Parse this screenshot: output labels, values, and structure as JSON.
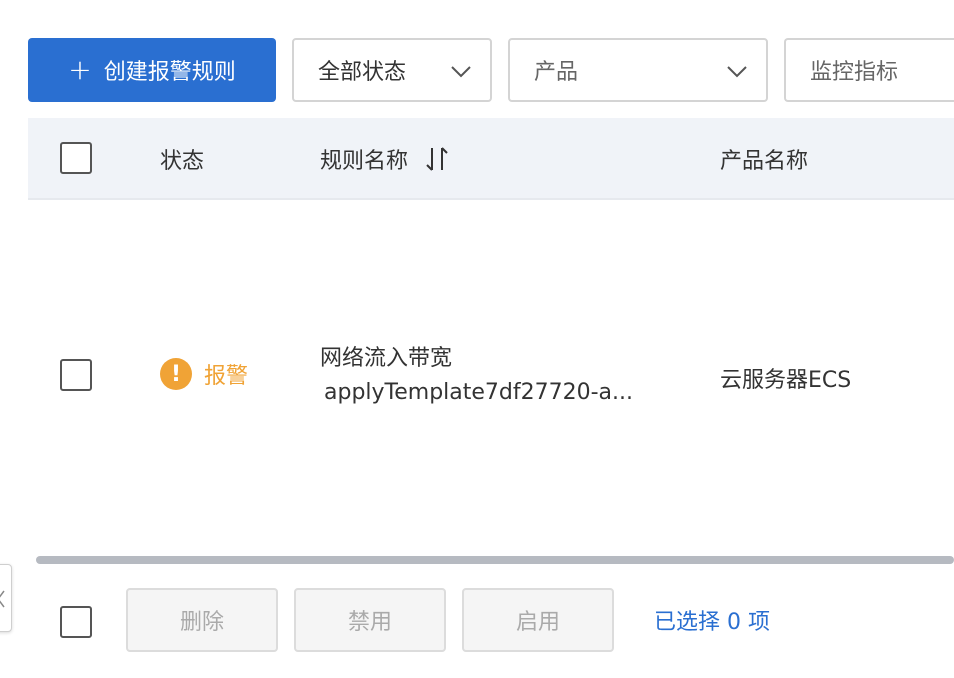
{
  "toolbar": {
    "create_label": "创建报警规则",
    "status_filter": "全部状态",
    "product_placeholder": "产品",
    "metric_placeholder": "监控指标"
  },
  "table": {
    "headers": {
      "status": "状态",
      "rule_name": "规则名称",
      "product_name": "产品名称"
    },
    "rows": [
      {
        "status": "报警",
        "rule_name": "网络流入带宽",
        "rule_id": "applyTemplate7df27720-a...",
        "product": "云服务器ECS"
      }
    ]
  },
  "footer": {
    "delete_label": "删除",
    "disable_label": "禁用",
    "enable_label": "启用",
    "selected_text": "已选择 0 项"
  },
  "colors": {
    "primary": "#2a6fd1",
    "warning": "#f0a336",
    "header_bg": "#f0f3f8"
  }
}
